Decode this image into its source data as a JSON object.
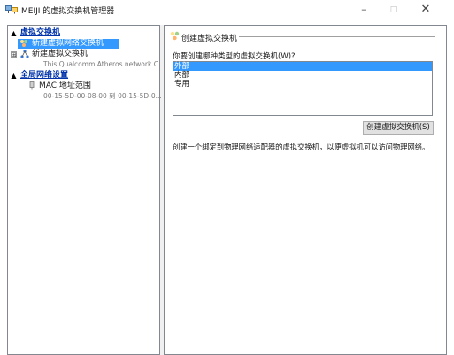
{
  "window": {
    "title": "MEIJI 的虚拟交换机管理器",
    "minimize": "–",
    "maximize": "□",
    "close": "✕"
  },
  "sidebar": {
    "virtual_switches": {
      "label": "虚拟交换机",
      "collapse_glyph": "▲",
      "items": [
        {
          "label": "新建虚拟网络交换机",
          "selected": true,
          "icon": "new-switch-icon"
        },
        {
          "label": "新建虚拟交换机",
          "subtitle": "This Qualcomm Atheros network C...",
          "expander": "⊞",
          "icon": "network-switch-icon"
        }
      ]
    },
    "global_network_settings": {
      "label": "全局网络设置",
      "collapse_glyph": "▲",
      "items": [
        {
          "label": "MAC 地址范围",
          "subtitle": "00-15-5D-00-08-00 到 00-15-5D-0...",
          "icon": "mac-address-icon"
        }
      ]
    }
  },
  "main": {
    "group_title": "创建虚拟交换机",
    "question": "你要创建哪种类型的虚拟交换机(W)?",
    "switch_types": [
      {
        "label": "外部",
        "selected": true
      },
      {
        "label": "内部",
        "selected": false
      },
      {
        "label": "专用",
        "selected": false
      }
    ],
    "create_button": "创建虚拟交换机(S)",
    "description": "创建一个绑定到物理网络适配器的虚拟交换机，以便虚拟机可以访问物理网络。"
  },
  "colors": {
    "selection": "#3399ff",
    "section_link": "#0033aa",
    "pane_border": "#828790"
  }
}
